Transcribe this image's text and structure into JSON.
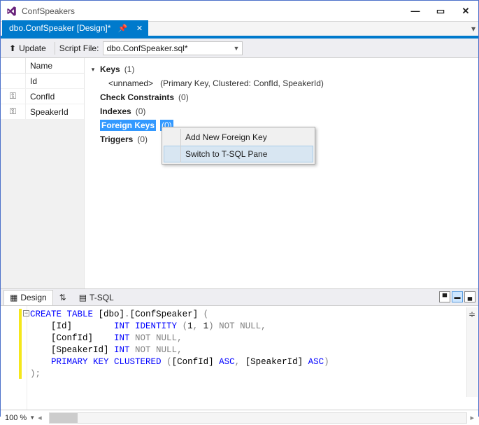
{
  "window": {
    "title": "ConfSpeakers"
  },
  "docTab": {
    "label": "dbo.ConfSpeaker [Design]*"
  },
  "toolbar": {
    "update_label": "Update",
    "scriptfile_label": "Script File:",
    "scriptfile_value": "dbo.ConfSpeaker.sql*"
  },
  "columns": {
    "header": "Name",
    "rows": [
      {
        "name": "Id",
        "key": false
      },
      {
        "name": "ConfId",
        "key": true
      },
      {
        "name": "SpeakerId",
        "key": true
      }
    ]
  },
  "tree": {
    "keys": {
      "label": "Keys",
      "count": "(1)",
      "child": {
        "name": "<unnamed>",
        "detail": "(Primary Key, Clustered: ConfId, SpeakerId)"
      }
    },
    "check": {
      "label": "Check Constraints",
      "count": "(0)"
    },
    "indexes": {
      "label": "Indexes",
      "count": "(0)"
    },
    "fkeys": {
      "label": "Foreign Keys",
      "count": "(0)"
    },
    "triggers": {
      "label": "Triggers",
      "count": "(0)"
    }
  },
  "contextMenu": {
    "items": [
      {
        "label": "Add New Foreign Key"
      },
      {
        "label": "Switch to T-SQL Pane"
      }
    ]
  },
  "paneTabs": {
    "design": "Design",
    "tsql": "T-SQL"
  },
  "code": {
    "l1a": "CREATE",
    "l1b": " TABLE ",
    "l1c": "[dbo]",
    "l1d": ".",
    "l1e": "[ConfSpeaker]",
    "l1f": " (",
    "l2a": "    [Id]        ",
    "l2b": "INT",
    "l2c": " IDENTITY ",
    "l2d": "(",
    "l2e": "1",
    "l2f": ", ",
    "l2g": "1",
    "l2h": ")",
    "l2i": " NOT NULL",
    "l2j": ",",
    "l3a": "    [ConfId]    ",
    "l3b": "INT",
    "l3c": " NOT NULL",
    "l3d": ",",
    "l4a": "    [SpeakerId] ",
    "l4b": "INT",
    "l4c": " NOT NULL",
    "l4d": ",",
    "l5a": "    ",
    "l5b": "PRIMARY",
    "l5c": " KEY CLUSTERED ",
    "l5d": "(",
    "l5e": "[ConfId] ",
    "l5f": "ASC",
    "l5g": ",",
    "l5h": " [SpeakerId] ",
    "l5i": "ASC",
    "l5j": ")",
    "l6a": ");"
  },
  "status": {
    "zoom": "100 %"
  }
}
